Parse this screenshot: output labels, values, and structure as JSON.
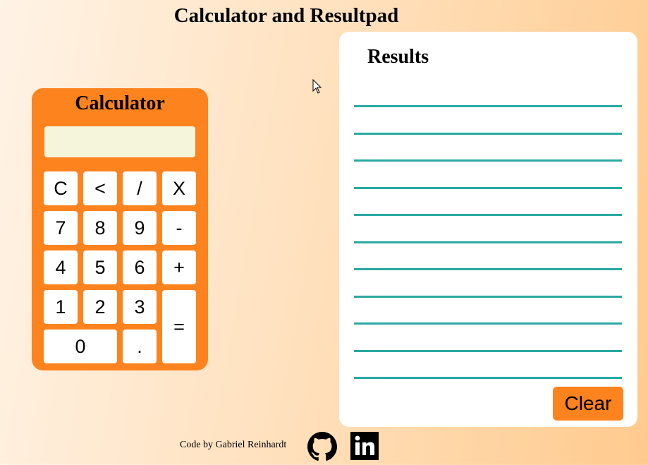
{
  "page": {
    "title": "Calculator and Resultpad"
  },
  "calculator": {
    "title": "Calculator",
    "display_value": "",
    "keys": {
      "clear": "C",
      "backspace": "<",
      "divide": "/",
      "multiply": "X",
      "seven": "7",
      "eight": "8",
      "nine": "9",
      "minus": "-",
      "four": "4",
      "five": "5",
      "six": "6",
      "plus": "+",
      "one": "1",
      "two": "2",
      "three": "3",
      "equals": "=",
      "zero": "0",
      "decimal": "."
    }
  },
  "results": {
    "title": "Results",
    "lines": [
      "",
      "",
      "",
      "",
      "",
      "",
      "",
      "",
      "",
      "",
      ""
    ],
    "clear_label": "Clear"
  },
  "footer": {
    "credit": "Code by Gabriel Reinhardt",
    "github_icon": "github-icon",
    "linkedin_icon": "linkedin-icon"
  },
  "colors": {
    "calculator_body": "#fd831e",
    "display_background": "#f5f5dc",
    "result_line": "#2aa8a3",
    "clear_button": "#fd831e"
  }
}
